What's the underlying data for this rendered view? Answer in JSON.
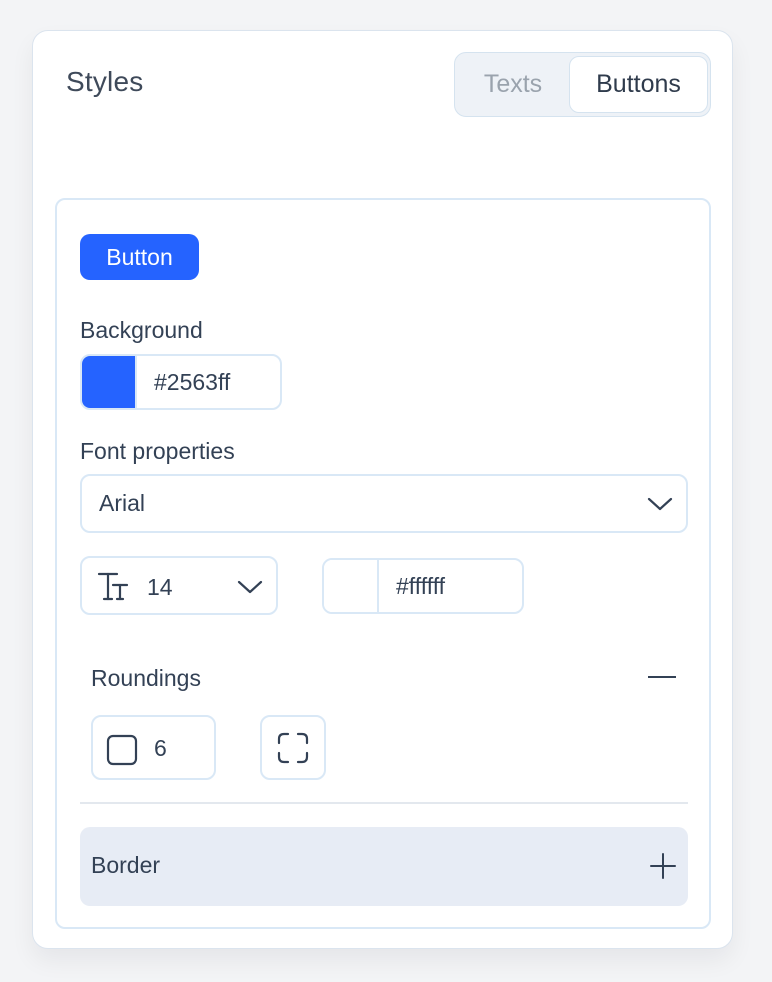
{
  "panel": {
    "title": "Styles",
    "tabs": [
      {
        "label": "Texts",
        "active": false
      },
      {
        "label": "Buttons",
        "active": true
      }
    ]
  },
  "preview": {
    "button_label": "Button",
    "background": "#2563ff",
    "text_color": "#ffffff"
  },
  "background": {
    "label": "Background",
    "color_value": "#2563ff",
    "swatch_color": "#2563ff"
  },
  "font": {
    "label": "Font properties",
    "family_value": "Arial",
    "size_value": "14",
    "size_icon": "text-size-icon",
    "color_value": "#ffffff",
    "swatch_color": "#ffffff"
  },
  "roundings": {
    "label": "Roundings",
    "value": "6",
    "collapse_icon": "minus-icon",
    "corner_icon": "square-icon",
    "individual_corners_icon": "corners-icon"
  },
  "border": {
    "label": "Border",
    "expand_icon": "plus-icon"
  },
  "colors": {
    "accent": "#2563ff",
    "border": "#d9e8f6",
    "section_bg": "#e7ecf5"
  }
}
